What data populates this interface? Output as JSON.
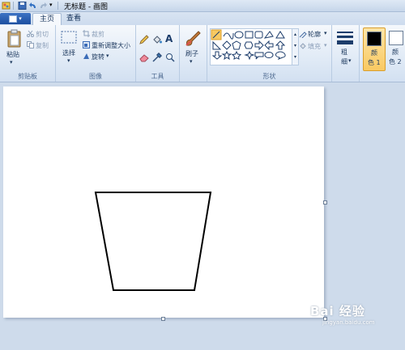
{
  "titlebar": {
    "title": "无标题 - 画图"
  },
  "tabs": [
    {
      "label": "主页"
    },
    {
      "label": "查看"
    }
  ],
  "clipboard": {
    "paste": "粘贴",
    "cut": "剪切",
    "copy": "复制",
    "group": "剪贴板"
  },
  "image": {
    "select": "选择",
    "crop": "裁剪",
    "resize": "重新调整大小",
    "rotate": "旋转",
    "group": "图像"
  },
  "tools": {
    "group": "工具"
  },
  "brushes": {
    "label": "刷子"
  },
  "shapes": {
    "outline": "轮廓",
    "fill": "填充",
    "group": "形状"
  },
  "size": {
    "label_1": "粗",
    "label_2": "细"
  },
  "colors": {
    "color1_1": "颜",
    "color1_2": "色 1",
    "color2_1": "颜",
    "color2_2": "色 2",
    "color1_value": "#000000",
    "color2_value": "#ffffff"
  },
  "watermark": {
    "text": "Bai 经验",
    "url": "jingyan.baidu.com"
  }
}
